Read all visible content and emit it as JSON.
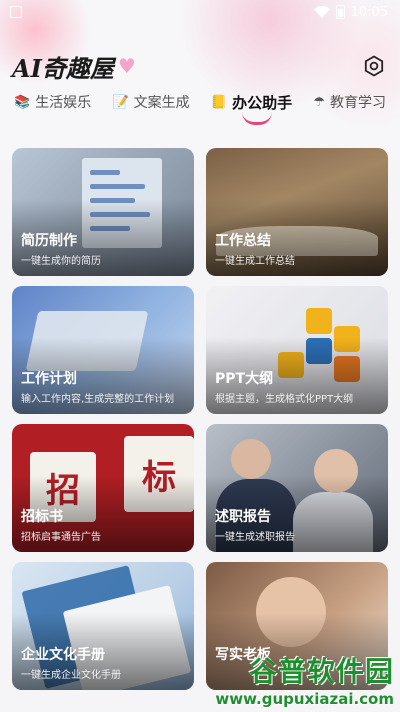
{
  "status_bar": {
    "time": "10:05"
  },
  "header": {
    "title": "AI奇趣屋"
  },
  "tabs": [
    {
      "label": "生活娱乐",
      "icon": "📚"
    },
    {
      "label": "文案生成",
      "icon": "📝"
    },
    {
      "label": "办公助手",
      "icon": "📒",
      "active": true
    },
    {
      "label": "教育学习",
      "icon": "☂"
    }
  ],
  "cards": [
    {
      "title": "简历制作",
      "subtitle": "一键生成你的简历"
    },
    {
      "title": "工作总结",
      "subtitle": "一键生成工作总结"
    },
    {
      "title": "工作计划",
      "subtitle": "输入工作内容,生成完整的工作计划"
    },
    {
      "title": "PPT大纲",
      "subtitle": "根据主题，生成格式化PPT大纲"
    },
    {
      "title": "招标书",
      "subtitle": "招标启事通告广告",
      "art_text": [
        "招",
        "标"
      ]
    },
    {
      "title": "述职报告",
      "subtitle": "一键生成述职报告"
    },
    {
      "title": "企业文化手册",
      "subtitle": "一键生成企业文化手册"
    },
    {
      "title": "写实老板",
      "subtitle": ""
    }
  ],
  "watermark": {
    "line1": "谷普软件园",
    "line2": "www.gupuxiazai.com"
  }
}
